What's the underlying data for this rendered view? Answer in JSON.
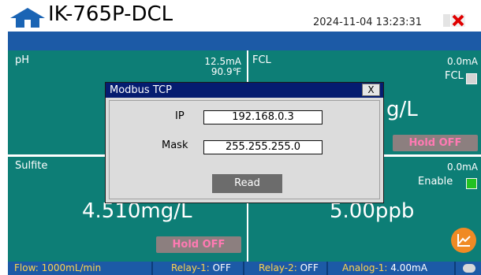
{
  "header": {
    "title": "IK-765P-DCL",
    "datetime": "2024-11-04 13:23:31"
  },
  "panels": {
    "ph": {
      "label": "pH",
      "current": "12.5mA",
      "temp": "90.9℉"
    },
    "fcl": {
      "label": "FCL",
      "current": "0.0mA",
      "toggle_label": "FCL",
      "value_fragment": "g/L",
      "hold": "Hold OFF"
    },
    "sulfite": {
      "label": "Sulfite",
      "value": "4.510mg/L",
      "hold": "Hold OFF"
    },
    "fourth": {
      "current": "0.0mA",
      "enable_label": "Enable",
      "value": "5.00ppb"
    }
  },
  "status_bar": {
    "flow": "Flow: 1000mL/min",
    "relay1_key": "Relay-1:",
    "relay1_val": " OFF",
    "relay2_key": "Relay-2:",
    "relay2_val": " OFF",
    "analog1_key": "Analog-1:",
    "analog1_val": " 4.00mA"
  },
  "dialog": {
    "title": "Modbus TCP",
    "close": "X",
    "ip_label": "IP",
    "ip_value": "192.168.0.3",
    "mask_label": "Mask",
    "mask_value": "255.255.255.0",
    "read_button": "Read"
  },
  "colors": {
    "panel": "#0d7e76",
    "bar": "#1c5aa6",
    "dialog_title": "#051c70",
    "hold_text": "#ff7ab3",
    "enable_green": "#22c222",
    "chart_button": "#f08a24"
  }
}
